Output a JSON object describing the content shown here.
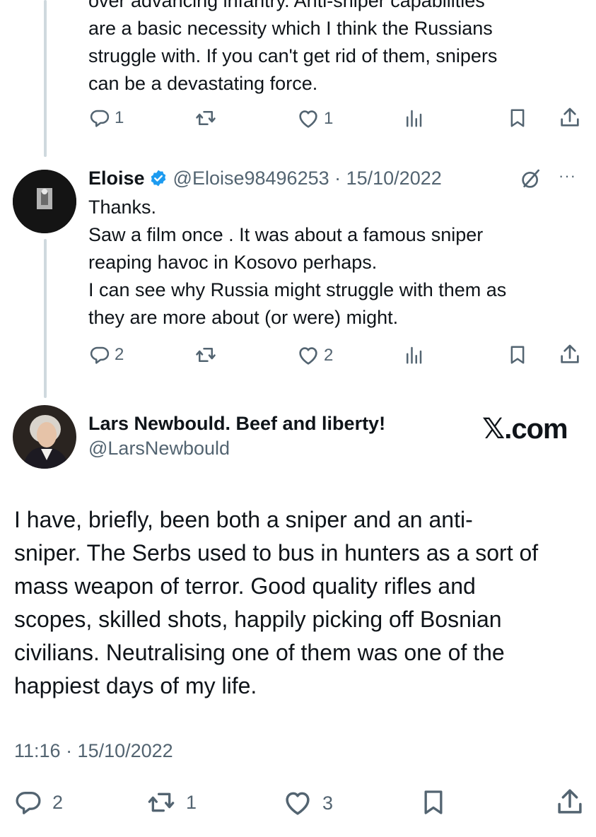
{
  "top_tweet": {
    "text_lines": [
      "over advancing infantry. Anti-sniper capabilities",
      "are a basic necessity which I think the Russians",
      "struggle with. If you can't get rid of them, snipers",
      "can be a devastating force."
    ],
    "actions": {
      "replies": "1",
      "likes": "1"
    }
  },
  "reply_tweet": {
    "display_name": "Eloise",
    "handle_date": "@Eloise98496253 · 15/10/2022",
    "more_label": "···",
    "text_lines": [
      "Thanks.",
      "Saw a film once . It was about a famous sniper",
      "reaping havoc in Kosovo perhaps.",
      "I can see why Russia might struggle with them as",
      "they are more about (or were) might."
    ],
    "actions": {
      "replies": "2",
      "likes": "2"
    }
  },
  "main_tweet": {
    "display_name": "Lars Newbould. Beef and liberty!",
    "handle": "@LarsNewbould",
    "brand": "𝕏.com",
    "text_lines": [
      "I have, briefly, been both a sniper and an anti-",
      "sniper. The Serbs used to bus in hunters as a sort of",
      "mass weapon of terror. Good quality rifles and",
      "scopes, skilled shots, happily picking off Bosnian",
      "civilians. Neutralising one of them was one of the",
      "happiest days of my life."
    ],
    "timestamp": "11:16 · 15/10/2022",
    "actions": {
      "replies": "2",
      "reposts": "1",
      "likes": "3"
    }
  },
  "colors": {
    "text": "#0f1419",
    "secondary": "#536471",
    "verified": "#1d9bf0",
    "thread_line": "#cfd9de"
  },
  "icons": [
    "reply-icon",
    "repost-icon",
    "like-icon",
    "views-icon",
    "bookmark-icon",
    "share-icon",
    "verified-icon",
    "grok-icon",
    "more-icon"
  ]
}
